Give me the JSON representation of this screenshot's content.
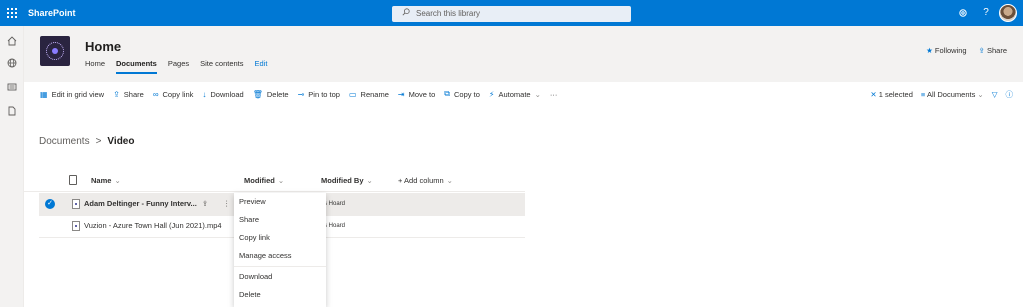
{
  "suite": {
    "app_name": "SharePoint",
    "search_placeholder": "Search this library",
    "icons": [
      "waffle-icon",
      "search-icon",
      "settings-icon",
      "help-icon"
    ],
    "help_glyph": "?"
  },
  "leftrail": {
    "icons": [
      "home-icon",
      "globe-icon",
      "news-icon",
      "document-icon"
    ]
  },
  "site": {
    "title": "Home",
    "nav": [
      "Home",
      "Documents",
      "Pages",
      "Site contents",
      "Edit"
    ],
    "active_nav": "Documents",
    "following_label": "Following",
    "share_label": "Share"
  },
  "commandbar": {
    "items": [
      {
        "label": "Edit in grid view",
        "icon": "grid-icon"
      },
      {
        "label": "Share",
        "icon": "share-icon"
      },
      {
        "label": "Copy link",
        "icon": "link-icon"
      },
      {
        "label": "Download",
        "icon": "download-icon"
      },
      {
        "label": "Delete",
        "icon": "delete-icon"
      },
      {
        "label": "Pin to top",
        "icon": "pin-icon"
      },
      {
        "label": "Rename",
        "icon": "rename-icon"
      },
      {
        "label": "Move to",
        "icon": "move-icon"
      },
      {
        "label": "Copy to",
        "icon": "copy-icon"
      },
      {
        "label": "Automate",
        "icon": "automate-icon"
      }
    ],
    "more_glyph": "···",
    "selected_label": "1 selected",
    "view_label": "All Documents"
  },
  "breadcrumb": {
    "root": "Documents",
    "separator": ">",
    "current": "Video"
  },
  "list": {
    "columns": {
      "name": "Name",
      "modified": "Modified",
      "modified_by": "Modified By",
      "add_column": "+ Add column"
    },
    "rows": [
      {
        "name": "Adam Deltinger - Funny Interv...",
        "modified_by": "nnis Hoard",
        "selected": true
      },
      {
        "name": "Vuzion - Azure Town Hall (Jun 2021).mp4",
        "modified_by": "nnis Hoard",
        "selected": false
      }
    ]
  },
  "context_menu": {
    "items": [
      "Preview",
      "Share",
      "Copy link",
      "Manage access",
      "Download",
      "Delete"
    ]
  },
  "colors": {
    "brand": "#0078d4",
    "header_bg": "#f3f2f1",
    "selected_row": "#edebe9"
  }
}
